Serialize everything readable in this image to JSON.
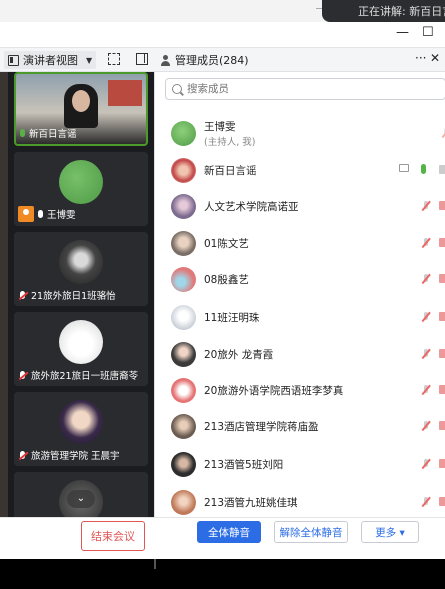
{
  "window": {
    "top_text": "正在讲解: 新百日言谣"
  },
  "toolbar": {
    "view_label": "演讲者视图",
    "members_label": "管理成员(284)",
    "more": "···",
    "close": "✕",
    "minimize": "—",
    "maximize": "☐"
  },
  "videos": [
    {
      "name": "新百日言谣",
      "mic": "on"
    },
    {
      "name": "王博雯",
      "mic": "on-white",
      "host": true
    },
    {
      "name": "21旅外旅日1班骆怡",
      "mic": "off"
    },
    {
      "name": "旅外旅21旅日一班唐裔苓",
      "mic": "off"
    },
    {
      "name": "旅游管理学院 王晨宇",
      "mic": "off"
    }
  ],
  "search": {
    "placeholder": "搜索成员"
  },
  "members": [
    {
      "name": "王博雯",
      "sub": "(主持人, 我)",
      "avatar_color": "#5fb35f"
    },
    {
      "name": "新百日言谣",
      "avatar_color": "#c24545"
    },
    {
      "name": "人文艺术学院高诺亚",
      "avatar_color": "#7d6b8f"
    },
    {
      "name": "01陈文艺",
      "avatar_color": "#7a6e66"
    },
    {
      "name": "08殷鑫艺",
      "avatar_color": "#e07a7a"
    },
    {
      "name": "11班汪明珠",
      "avatar_color": "#c9ced6"
    },
    {
      "name": "20旅外 龙青霞",
      "avatar_color": "#3b3b3b"
    },
    {
      "name": "20旅游外语学院西语班李梦真",
      "avatar_color": "#e57373"
    },
    {
      "name": "213酒店管理学院蒋庙盈",
      "avatar_color": "#6b5c52"
    },
    {
      "name": "213酒管5班刘阳",
      "avatar_color": "#2d2d2d"
    },
    {
      "name": "213酒管九班姚佳琪",
      "avatar_color": "#c07a5a"
    }
  ],
  "footer": {
    "end_meeting": "结束会议",
    "mute_all": "全体静音",
    "unmute_all": "解除全体静音",
    "more": "更多 ▾"
  },
  "colors": {
    "accent": "#2c6de6",
    "danger": "#e05656",
    "active_green": "#4c9a2a"
  }
}
